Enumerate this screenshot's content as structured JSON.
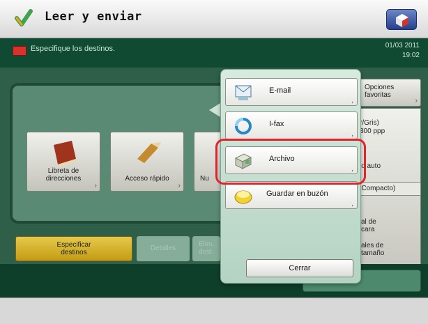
{
  "header": {
    "title": "Leer y enviar",
    "help_icon": "help-cube-icon"
  },
  "message": {
    "text": "Especifique los destinos.",
    "date": "01/03 2011",
    "time": "19:02"
  },
  "destination_buttons": [
    {
      "label": "Libreta de\ndirecciones",
      "icon": "address-book-icon"
    },
    {
      "label": "Acceso rápido",
      "icon": "quick-access-icon"
    },
    {
      "label": "Nu",
      "icon": "new-destination-icon"
    }
  ],
  "right_column": {
    "favorites": "Opciones\nfavoritas",
    "color_line1": "r/Gris)",
    "color_line2": "300 ppp",
    "auto": "lo auto",
    "compact": "(Compacto)",
    "original_line1": "al de",
    "original_line2": "cara",
    "size_line1": "ales de",
    "size_line2": "tamaño"
  },
  "bottom_buttons": {
    "specify": "Especificar\ndestinos",
    "details": "Detalles",
    "delete": "Elim.\ndest."
  },
  "popup": {
    "items": [
      {
        "label": "E-mail",
        "icon": "email-icon"
      },
      {
        "label": "I-fax",
        "icon": "ifax-icon"
      },
      {
        "label": "Archivo",
        "icon": "file-archive-icon"
      },
      {
        "label": "Guardar en buzón",
        "icon": "mailbox-icon"
      }
    ],
    "close_label": "Cerrar"
  },
  "colors": {
    "green_bg": "#2f5f48",
    "highlight": "#e0242b",
    "yellow_button": "#d7b527"
  }
}
